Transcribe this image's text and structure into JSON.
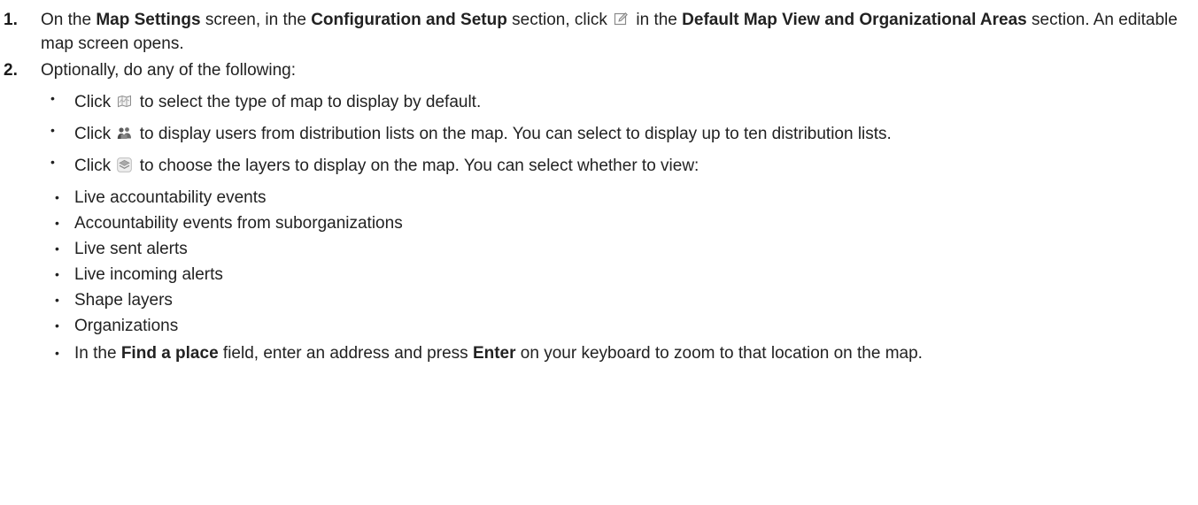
{
  "step1": {
    "number": "1.",
    "t1": "On the ",
    "b1": "Map Settings",
    "t2": " screen, in the ",
    "b2": "Configuration and Setup",
    "t3": " section, click ",
    "t4": " in the ",
    "b3": "Default Map View and Organizational Areas",
    "t5": " section. An editable map screen opens.",
    "icon": "edit-icon"
  },
  "step2": {
    "number": "2.",
    "text": "Optionally, do any of the following:",
    "items": [
      {
        "bullet": "•",
        "pre": "Click ",
        "icon": "map-type-icon",
        "post": " to select the type of map to display by default."
      },
      {
        "bullet": "•",
        "pre": "Click ",
        "icon": "distribution-list-users-icon",
        "post": " to display users from distribution lists on the map. You can select to display up to ten distribution lists."
      },
      {
        "bullet": "•",
        "pre": "Click ",
        "icon": "layers-icon",
        "post": " to choose the layers to display on the map. You can select whether to view:"
      }
    ],
    "layers": [
      "Live accountability events",
      "Accountability events from suborganizations",
      "Live sent alerts",
      "Live incoming alerts",
      "Shape layers",
      "Organizations"
    ],
    "nested_bullet": "•",
    "find": {
      "bullet": "•",
      "t1": "In the ",
      "b1": "Find a place",
      "t2": " field, enter an address and press ",
      "b2": "Enter",
      "t3": " on your keyboard to zoom to that location on the map."
    }
  }
}
